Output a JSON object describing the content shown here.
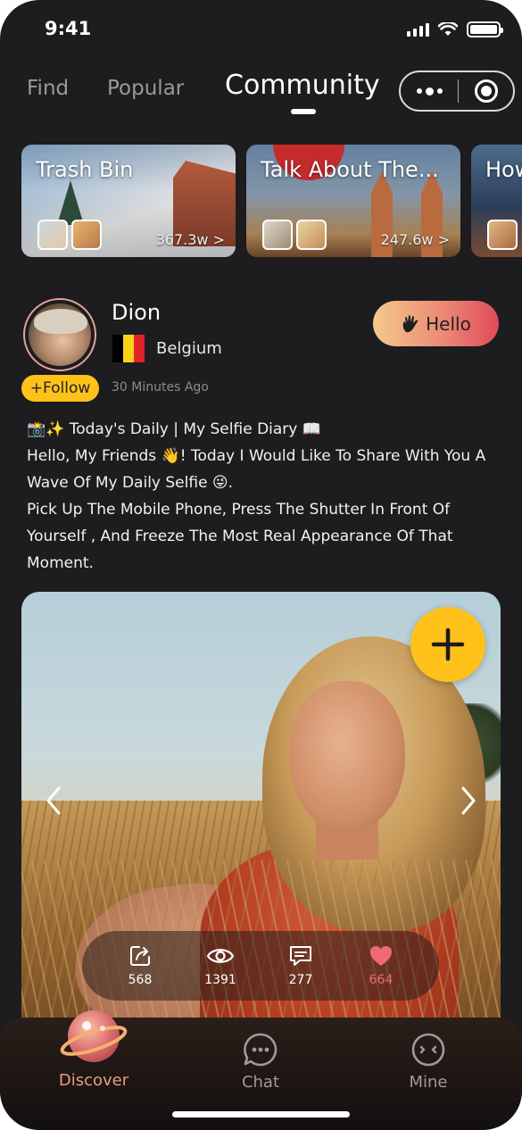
{
  "status_bar": {
    "time": "9:41"
  },
  "nav": {
    "tabs": [
      {
        "label": "Find",
        "active": false
      },
      {
        "label": "Popular",
        "active": false
      },
      {
        "label": "Community",
        "active": true
      }
    ]
  },
  "topics": [
    {
      "title": "Trash Bin",
      "count": "367.3w"
    },
    {
      "title": "Talk About The...",
      "count": "247.6w"
    },
    {
      "title": "How",
      "count": ""
    }
  ],
  "post": {
    "username": "Dion",
    "country": "Belgium",
    "follow_label": "+Follow",
    "time_ago": "30 Minutes Ago",
    "hello_label": "Hello",
    "text_lines": [
      "📸✨ Today's Daily | My Selfie Diary 📖",
      "Hello, My Friends 👋! Today I Would Like To Share With You A Wave Of My Daily Selfie 😜.",
      "Pick Up The Mobile Phone, Press The Shutter In Front Of Yourself , And Freeze The Most Real Appearance Of That Moment."
    ],
    "stats": {
      "shares": "568",
      "views": "1391",
      "comments": "277",
      "likes": "664"
    }
  },
  "bottom_nav": [
    {
      "label": "Discover",
      "active": true
    },
    {
      "label": "Chat",
      "active": false
    },
    {
      "label": "Mine",
      "active": false
    }
  ],
  "colors": {
    "background": "#1d1c1e",
    "accent_yellow": "#ffc21a",
    "hello_gradient_start": "#f4c98d",
    "hello_gradient_end": "#e04b5a",
    "like_color": "#f06a74",
    "active_nav": "#e89d7d"
  },
  "icons": {
    "status": [
      "signal-icon",
      "wifi-icon",
      "battery-icon"
    ],
    "capsule": [
      "more-dots-icon",
      "target-icon"
    ],
    "hello": "wave-hand-icon",
    "photo": [
      "plus-icon",
      "chevron-left-icon",
      "chevron-right-icon"
    ],
    "stats": [
      "share-icon",
      "eye-icon",
      "comment-icon",
      "heart-icon"
    ],
    "bottom_nav": [
      "planet-icon",
      "chat-bubble-icon",
      "face-icon"
    ]
  }
}
